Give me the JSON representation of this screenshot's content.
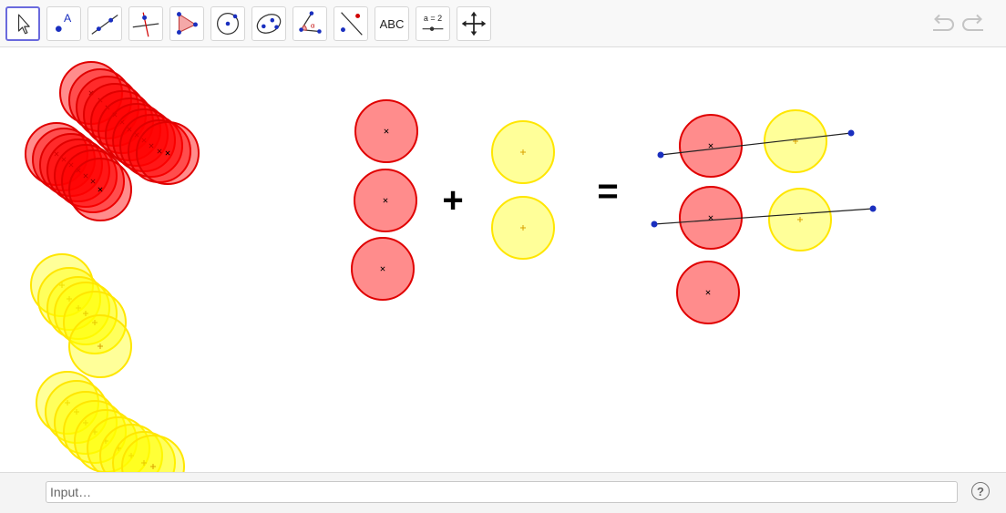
{
  "toolbar": {
    "tools": [
      {
        "name": "move-tool-button",
        "icon": "arrow-cursor-icon"
      },
      {
        "name": "point-tool-button",
        "icon": "point-icon"
      },
      {
        "name": "line-tool-button",
        "icon": "line-through-points-icon"
      },
      {
        "name": "perpendicular-line-tool-button",
        "icon": "perpendicular-line-icon"
      },
      {
        "name": "polygon-tool-button",
        "icon": "polygon-icon"
      },
      {
        "name": "circle-tool-button",
        "icon": "circle-center-point-icon"
      },
      {
        "name": "conic-tool-button",
        "icon": "ellipse-icon"
      },
      {
        "name": "angle-tool-button",
        "icon": "angle-icon"
      },
      {
        "name": "reflect-tool-button",
        "icon": "reflect-about-line-icon"
      },
      {
        "name": "text-tool-button",
        "label": "ABC"
      },
      {
        "name": "slider-tool-button",
        "label": "a = 2"
      },
      {
        "name": "move-graphics-view-button",
        "icon": "move-arrows-icon"
      }
    ],
    "undo_icon": "undo-icon",
    "redo_icon": "redo-icon"
  },
  "canvas": {
    "plus_symbol": "+",
    "equals_symbol": "=",
    "colors": {
      "red_fill": "#ff0000",
      "red_stroke": "#e00000",
      "yellow_fill": "#ffff00",
      "yellow_stroke": "#ffe600",
      "point_blue": "#1a2fbf",
      "segment": "#222222"
    }
  },
  "inputbar": {
    "placeholder": "Input…",
    "help_label": "?"
  }
}
